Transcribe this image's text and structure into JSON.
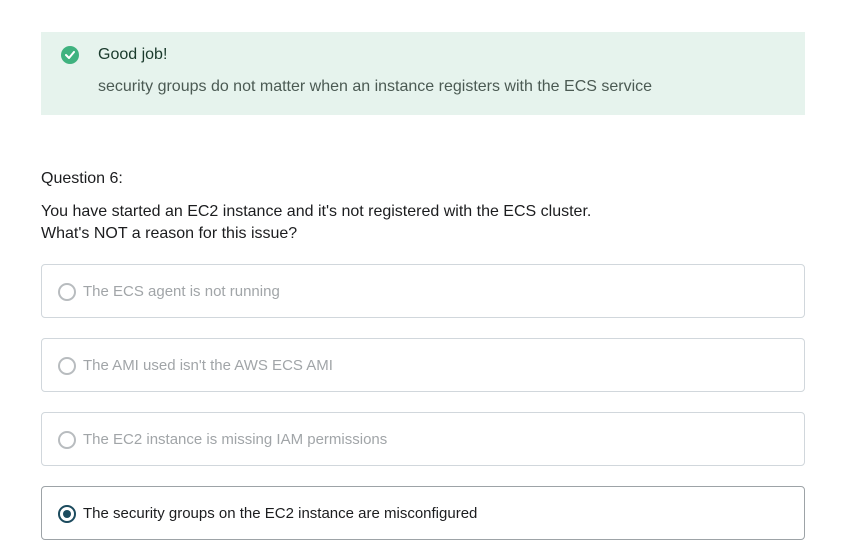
{
  "feedback": {
    "title": "Good job!",
    "message": "security groups do not matter when an instance registers with the ECS service",
    "icon": "check-circle-icon",
    "color": "#3fb27f",
    "background": "#e6f3ed"
  },
  "question": {
    "number_label": "Question 6:",
    "lines": [
      "You have started an EC2 instance and it's not registered with the ECS cluster.",
      "What's NOT a reason for this issue?"
    ]
  },
  "options": [
    {
      "label": "The ECS agent is not running",
      "selected": false
    },
    {
      "label": "The AMI used isn't the AWS ECS AMI",
      "selected": false
    },
    {
      "label": "The EC2 instance is missing IAM permissions",
      "selected": false
    },
    {
      "label": "The security groups on the EC2 instance are misconfigured",
      "selected": true
    }
  ],
  "colors": {
    "selected_radio": "#1c4b5e",
    "unselected_text": "#a1a5a8",
    "border": "#d1d7dc"
  }
}
